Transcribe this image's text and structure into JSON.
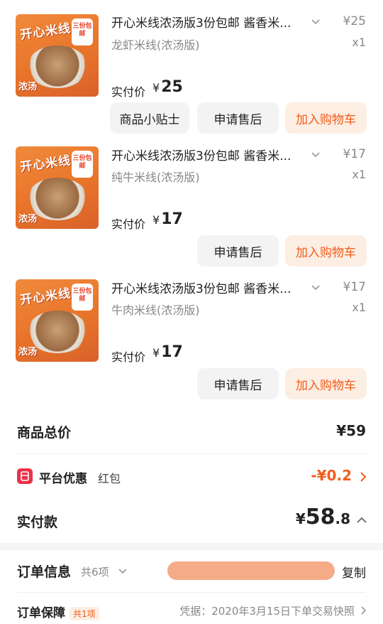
{
  "items": [
    {
      "title": "开心米线浓汤版3份包邮 酱香米...",
      "price": "¥25",
      "spec": "龙虾米线(浓汤版)",
      "qty": "x1",
      "paid_label": "实付价",
      "paid_currency": "¥",
      "paid_value": "25",
      "thumb_title": "开心米线",
      "thumb_tag": "三份包邮",
      "thumb_side": "浓汤",
      "buttons": [
        "商品小贴士",
        "申请售后",
        "加入购物车"
      ]
    },
    {
      "title": "开心米线浓汤版3份包邮 酱香米...",
      "price": "¥17",
      "spec": "纯牛米线(浓汤版)",
      "qty": "x1",
      "paid_label": "实付价",
      "paid_currency": "¥",
      "paid_value": "17",
      "thumb_title": "开心米线",
      "thumb_tag": "三份包邮",
      "thumb_side": "浓汤",
      "buttons": [
        "申请售后",
        "加入购物车"
      ]
    },
    {
      "title": "开心米线浓汤版3份包邮 酱香米...",
      "price": "¥17",
      "spec": "牛肉米线(浓汤版)",
      "qty": "x1",
      "paid_label": "实付价",
      "paid_currency": "¥",
      "paid_value": "17",
      "thumb_title": "开心米线",
      "thumb_tag": "三份包邮",
      "thumb_side": "浓汤",
      "buttons": [
        "申请售后",
        "加入购物车"
      ]
    }
  ],
  "summary": {
    "total_label": "商品总价",
    "total_value": "¥59",
    "discount_label": "平台优惠",
    "discount_sub": "红包",
    "discount_value": "-¥0.2",
    "paid_label": "实付款",
    "paid_currency": "¥",
    "paid_int": "58",
    "paid_dec": ".8"
  },
  "order_info": {
    "label": "订单信息",
    "count": "共6项",
    "copy": "复制"
  },
  "guarantee": {
    "label": "订单保障",
    "badge": "共1项",
    "text": "凭据：2020年3月15日下单交易快照"
  },
  "colors": {
    "accent": "#f25d1c",
    "accent_bg": "#fdeee3",
    "discount_icon": "#e8334a",
    "redaction": "#f4a27a"
  }
}
